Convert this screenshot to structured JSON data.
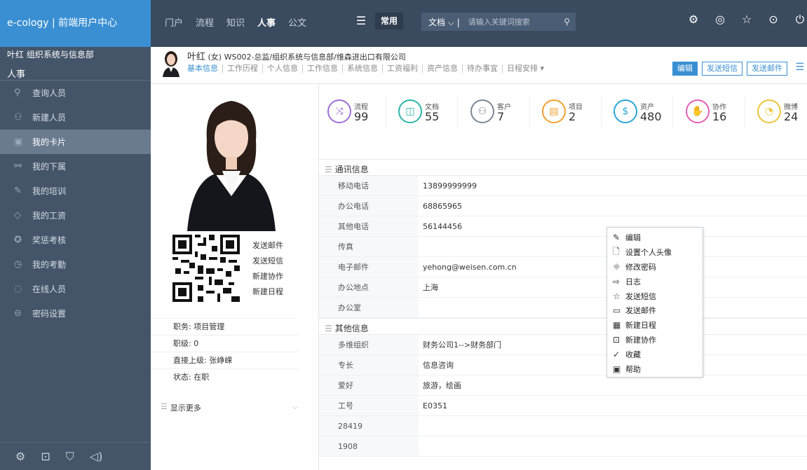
{
  "brand": {
    "title": "e-cology | 前端用户中心"
  },
  "topnav": {
    "items": [
      "门户",
      "流程",
      "知识",
      "人事",
      "公文"
    ],
    "active": "人事",
    "menu_icon": "menu-icon",
    "common_label": "常用",
    "search": {
      "scope": "文档",
      "placeholder": "请输入关键词搜索"
    },
    "icons": [
      "settings-icon",
      "theme-icon",
      "star-icon",
      "more-icon",
      "power-icon"
    ]
  },
  "sidebar": {
    "dept": "叶红  组织系统与信息部",
    "section": "人事",
    "items": [
      {
        "label": "查询人员",
        "icon": "search-icon"
      },
      {
        "label": "新建人员",
        "icon": "user-icon"
      },
      {
        "label": "我的卡片",
        "icon": "card-icon",
        "active": true
      },
      {
        "label": "我的下属",
        "icon": "org-icon"
      },
      {
        "label": "我的培训",
        "icon": "train-icon"
      },
      {
        "label": "我的工资",
        "icon": "money-icon"
      },
      {
        "label": "奖惩考核",
        "icon": "medal-icon"
      },
      {
        "label": "我的考勤",
        "icon": "clock-icon"
      },
      {
        "label": "在线人员",
        "icon": "location-icon"
      },
      {
        "label": "密码设置",
        "icon": "lock-icon"
      }
    ]
  },
  "profile": {
    "name": "叶红",
    "gender": "(女)",
    "info": "WS002-总监/组织系统与信息部/维森进出口有限公司",
    "tabs": [
      "基本信息",
      "工作历程",
      "个人信息",
      "工作信息",
      "系统信息",
      "工资福利",
      "资产信息",
      "待办事宜",
      "日程安排 ▾"
    ],
    "buttons": {
      "edit": "编辑",
      "sms": "发送短信",
      "mail": "发送邮件"
    }
  },
  "qr_actions": [
    "发送邮件",
    "发送短信",
    "新建协作",
    "新建日程"
  ],
  "left_info": [
    "职务: 项目管理",
    "职级: 0",
    "直接上级: 张峥嵘",
    "状态: 在职"
  ],
  "show_more": "显示更多",
  "stats": [
    {
      "label": "流程",
      "value": "99",
      "color": "#9b6fd6",
      "icon": "⤨"
    },
    {
      "label": "文档",
      "value": "55",
      "color": "#2bb5a8",
      "icon": "◫"
    },
    {
      "label": "客户",
      "value": "7",
      "color": "#7b8794",
      "icon": "⚇"
    },
    {
      "label": "项目",
      "value": "2",
      "color": "#f0a030",
      "icon": "▤"
    },
    {
      "label": "资产",
      "value": "480",
      "color": "#2aa6d8",
      "icon": "$"
    },
    {
      "label": "协作",
      "value": "16",
      "color": "#e45fb5",
      "icon": "✋"
    },
    {
      "label": "微博",
      "value": "24",
      "color": "#f0c43a",
      "icon": "◔"
    }
  ],
  "comm": {
    "title": "通讯信息",
    "rows": [
      {
        "k": "移动电话",
        "v": "13899999999"
      },
      {
        "k": "办公电话",
        "v": "68865965"
      },
      {
        "k": "其他电话",
        "v": "56144456"
      },
      {
        "k": "传真",
        "v": ""
      },
      {
        "k": "电子邮件",
        "v": "yehong@weisen.com.cn"
      },
      {
        "k": "办公地点",
        "v": "上海"
      },
      {
        "k": "办公室",
        "v": ""
      }
    ]
  },
  "other": {
    "title": "其他信息",
    "rows": [
      {
        "k": "多维组织",
        "v": "财务公司1-->财务部门"
      },
      {
        "k": "专长",
        "v": "信息咨询"
      },
      {
        "k": "爱好",
        "v": "旅游，绘画"
      },
      {
        "k": "工号",
        "v": "E0351"
      },
      {
        "k": "28419",
        "v": ""
      },
      {
        "k": "1908",
        "v": ""
      }
    ]
  },
  "context_menu": [
    {
      "label": "编辑",
      "icon": "✎"
    },
    {
      "label": "设置个人头像",
      "icon": "🗋"
    },
    {
      "label": "修改密码",
      "icon": "☼"
    },
    {
      "label": "日志",
      "icon": "⇨"
    },
    {
      "label": "发送短信",
      "icon": "☆"
    },
    {
      "label": "发送邮件",
      "icon": "▭"
    },
    {
      "label": "新建日程",
      "icon": "▦"
    },
    {
      "label": "新建协作",
      "icon": "⊡"
    },
    {
      "label": "收藏",
      "icon": "✓"
    },
    {
      "label": "帮助",
      "icon": "▣"
    }
  ]
}
